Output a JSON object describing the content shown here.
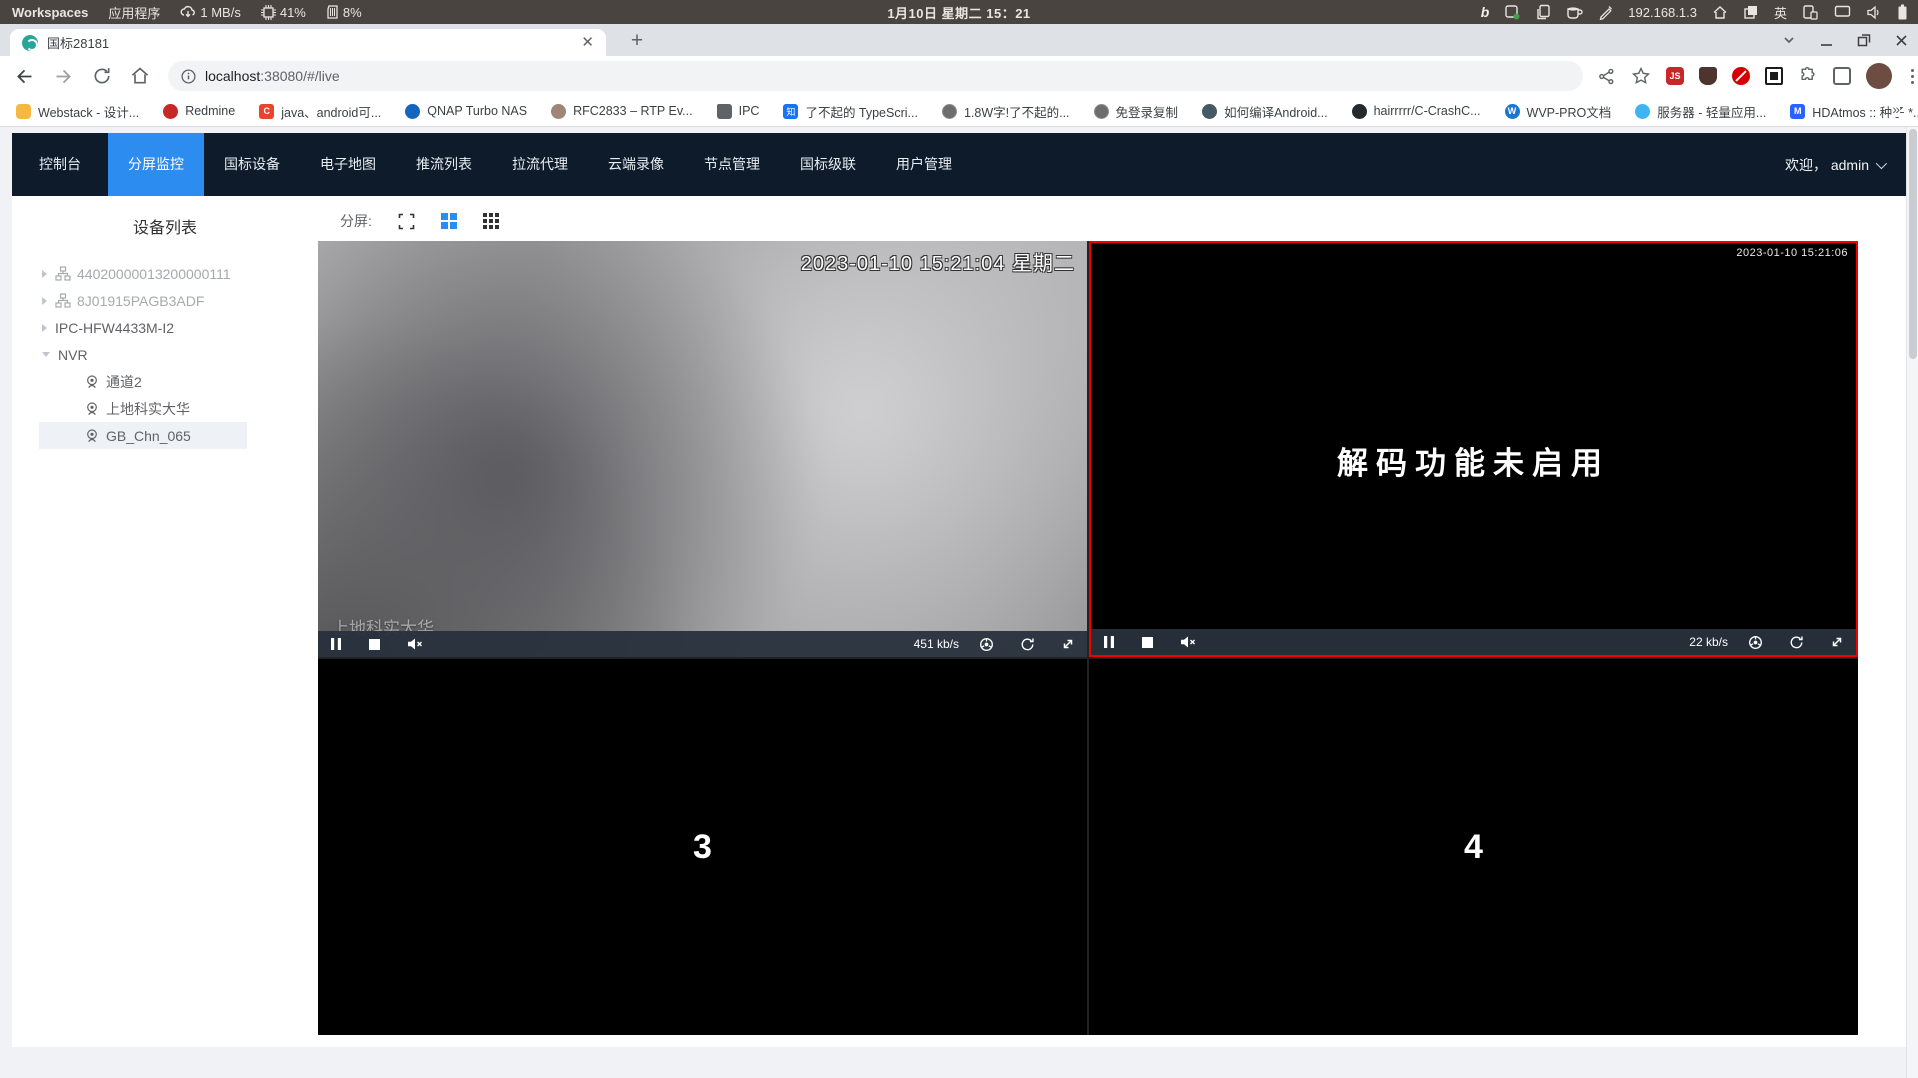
{
  "system_bar": {
    "workspaces": "Workspaces",
    "applications": "应用程序",
    "net_speed": "1 MB/s",
    "cpu": "41%",
    "mem": "8%",
    "clock": "1月10日 星期二 15：21",
    "ip": "192.168.1.3",
    "input_method": "英"
  },
  "browser": {
    "tab_title": "国标28181",
    "url_host": "localhost",
    "url_rest": ":38080/#/live",
    "newtab_label": "+",
    "bookmarks_overflow": "»",
    "bookmarks": [
      {
        "icon": "bm-webstack",
        "label": "Webstack - 设计..."
      },
      {
        "icon": "bm-redmine",
        "label": "Redmine"
      },
      {
        "icon": "bm-javac",
        "label": "java、android可..."
      },
      {
        "icon": "bm-qnap",
        "label": "QNAP Turbo NAS"
      },
      {
        "icon": "bm-rfc",
        "label": "RFC2833 – RTP Ev..."
      },
      {
        "icon": "bm-folder",
        "label": "IPC"
      },
      {
        "icon": "bm-zhihu",
        "label": "了不起的 TypeScri..."
      },
      {
        "icon": "bm-globe1",
        "label": "1.8W字!了不起的..."
      },
      {
        "icon": "bm-globe2",
        "label": "免登录复制"
      },
      {
        "icon": "bm-android",
        "label": "如何编译Android..."
      },
      {
        "icon": "bm-github",
        "label": "hairrrrr/C-CrashC..."
      },
      {
        "icon": "bm-wvp",
        "label": "WVP-PRO文档"
      },
      {
        "icon": "bm-cloud",
        "label": "服务器 - 轻量应用..."
      },
      {
        "icon": "bm-hdatmos",
        "label": "HDAtmos :: 种子 *..."
      }
    ]
  },
  "nav": {
    "items": [
      {
        "label": "控制台",
        "state": ""
      },
      {
        "label": "分屏监控",
        "state": "active"
      },
      {
        "label": "国标设备",
        "state": ""
      },
      {
        "label": "电子地图",
        "state": ""
      },
      {
        "label": "推流列表",
        "state": ""
      },
      {
        "label": "拉流代理",
        "state": ""
      },
      {
        "label": "云端录像",
        "state": ""
      },
      {
        "label": "节点管理",
        "state": ""
      },
      {
        "label": "国标级联",
        "state": ""
      },
      {
        "label": "用户管理",
        "state": ""
      }
    ],
    "welcome": "欢迎， admin"
  },
  "sidebar": {
    "title": "设备列表",
    "devices": [
      {
        "label": "44020000013200000111"
      },
      {
        "label": "8J01915PAGB3ADF"
      },
      {
        "label": "IPC-HFW4433M-I2"
      },
      {
        "label": "NVR"
      }
    ],
    "channels": [
      {
        "label": "通道2"
      },
      {
        "label": "上地科实大华"
      },
      {
        "label": "GB_Chn_065"
      }
    ]
  },
  "toolbar": {
    "split_label": "分屏:"
  },
  "cells": {
    "c1": {
      "timestamp": "2023-01-10 15:21:04 星期二",
      "watermark": "上地科实大华",
      "bitrate": "451 kb/s"
    },
    "c2": {
      "timestamp": "2023-01-10 15:21:06",
      "message": "解码功能未启用",
      "bitrate": "22 kb/s"
    },
    "c3": {
      "label": "3"
    },
    "c4": {
      "label": "4"
    }
  },
  "colors": {
    "accent": "#2d8cf0",
    "nav_bg": "#0d1b2b",
    "selected_border": "#f20000"
  }
}
